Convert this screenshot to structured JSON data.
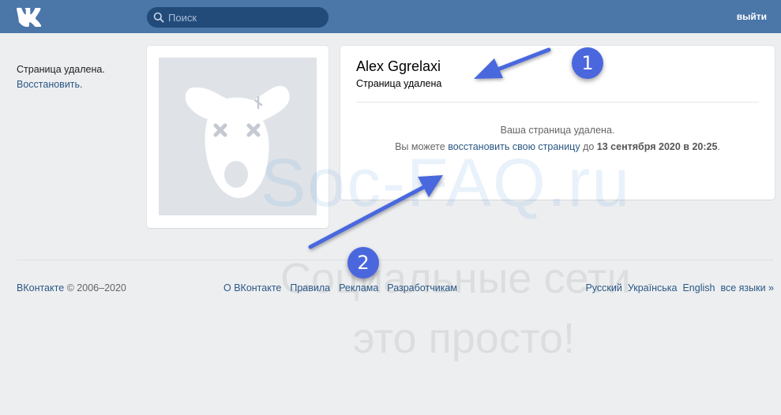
{
  "header": {
    "logo_icon": "vk-logo-icon",
    "search": {
      "placeholder": "Поиск",
      "icon": "search-icon"
    },
    "logout_label": "выйти",
    "bg_color": "#4a76a8"
  },
  "sidebar": {
    "status_text": "Страница удалена.",
    "restore_link": "Восстановить."
  },
  "profile": {
    "avatar_icon": "deactivated-dog-avatar-icon",
    "name": "Alex Ggrelaxi",
    "status": "Страница удалена",
    "message_line1": "Ваша страница удалена.",
    "message_line2_prefix": "Вы можете ",
    "message_line2_link": "восстановить свою страницу",
    "message_line2_mid": " до ",
    "message_line2_date": "13 сентября 2020 в 20:25",
    "message_line2_suffix": "."
  },
  "footer": {
    "brand": "ВКонтакте",
    "copyright": " © 2006–2020",
    "links": [
      "О ВКонтакте",
      "Правила",
      "Реклама",
      "Разработчикам"
    ],
    "languages": [
      "Русский",
      "Українська",
      "English",
      "все языки »"
    ]
  },
  "watermark": {
    "line1": "Soc-FAQ.ru",
    "line2": "Социальные сети",
    "line3": "это просто!"
  },
  "annotations": {
    "badge1": "1",
    "badge2": "2",
    "color": "#4a67de"
  }
}
